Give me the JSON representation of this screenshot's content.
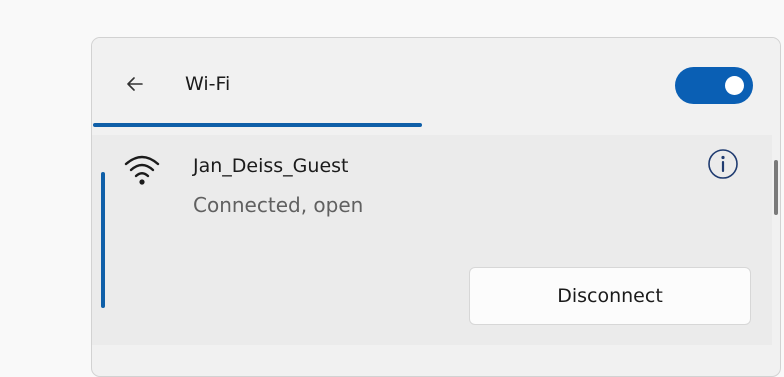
{
  "header": {
    "back_icon": "back-arrow-icon",
    "title": "Wi-Fi",
    "wifi_toggle": {
      "state": "on",
      "color": "#0a5fb4"
    }
  },
  "network": {
    "name": "Jan_Deiss_Guest",
    "status": "Connected, open",
    "signal_icon": "wifi-signal-icon",
    "info_icon": "info-icon",
    "disconnect_label": "Disconnect",
    "selected": true
  },
  "colors": {
    "accent": "#0f5fa8",
    "panel_bg": "#f1f1f1",
    "item_bg": "#ebebeb",
    "text": "#1b1b1b",
    "secondary_text": "#606060"
  }
}
